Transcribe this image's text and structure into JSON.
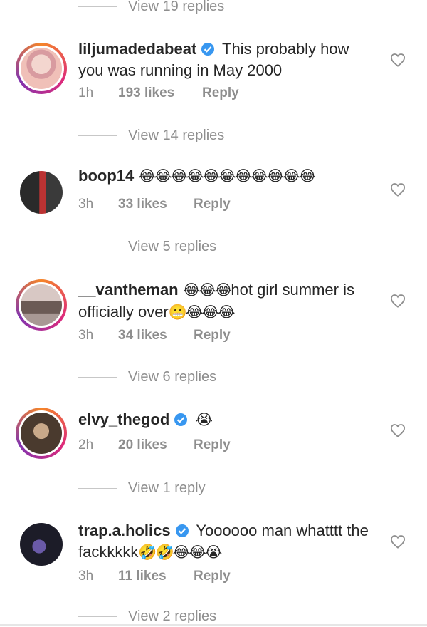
{
  "threads": [
    {
      "pre_replies": "View 19 replies",
      "username": "liljumadedabeat",
      "verified": true,
      "message": "This probably how you was running in May 2000",
      "emojis": "",
      "time": "1h",
      "likes": "193 likes",
      "reply": "Reply",
      "post_replies": "View 14 replies",
      "avatar_color": "#e9c9c0"
    },
    {
      "username": "boop14",
      "verified": false,
      "message": "",
      "emojis": "😂😂😂😂😂😂😂😂😂😂😂",
      "time": "3h",
      "likes": "33 likes",
      "reply": "Reply",
      "post_replies": "View 5 replies",
      "avatar_color": "#3a3a3a"
    },
    {
      "username": "__vantheman",
      "verified": false,
      "message_parts": [
        "😂😂😂",
        "hot girl summer is officially over",
        "😬😂😂😂"
      ],
      "time": "3h",
      "likes": "34 likes",
      "reply": "Reply",
      "post_replies": "View 6 replies",
      "avatar_color": "#7a6a66"
    },
    {
      "username": "elvy_thegod",
      "verified": true,
      "emojis": "😭",
      "time": "2h",
      "likes": "20 likes",
      "reply": "Reply",
      "post_replies": "View 1 reply",
      "avatar_color": "#5a4a3c"
    },
    {
      "username": "trap.a.holics",
      "verified": true,
      "message": "Yoooooo man whatttt the fackkkkk",
      "emojis": "🤣🤣😂😂😭",
      "time": "3h",
      "likes": "11 likes",
      "reply": "Reply",
      "post_replies": "View 2 replies",
      "avatar_color": "#2b2b3a"
    }
  ],
  "colors": {
    "verified": "#3897f0",
    "meta_text": "#8e8e8e",
    "body_text": "#262626"
  },
  "icons": {
    "like": "heart-outline-icon",
    "verified": "verified-badge-icon"
  }
}
